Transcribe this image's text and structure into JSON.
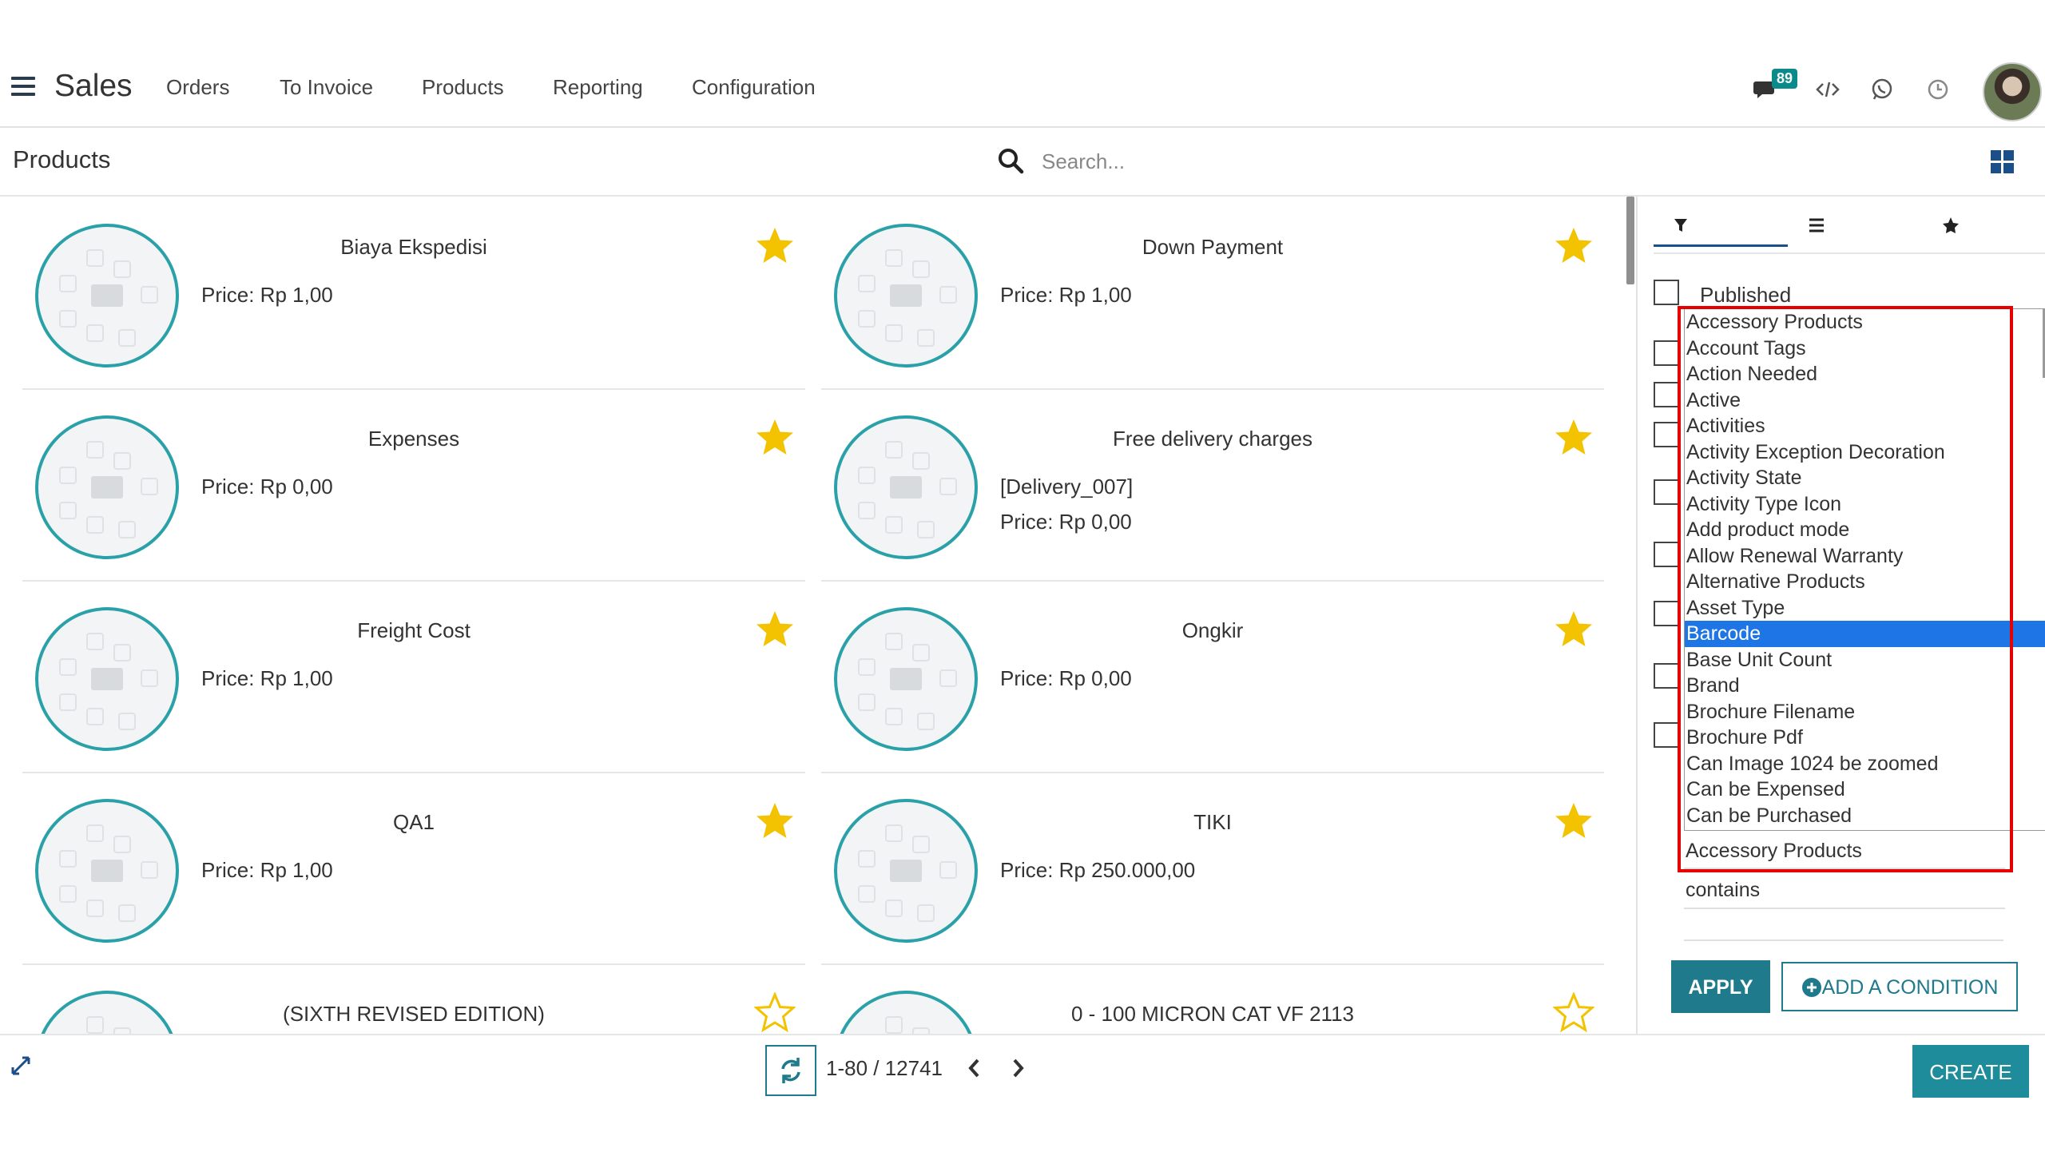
{
  "app": {
    "title": "Sales",
    "notification_count": "89"
  },
  "menu": [
    "Orders",
    "To Invoice",
    "Products",
    "Reporting",
    "Configuration"
  ],
  "breadcrumb": "Products",
  "search": {
    "placeholder": "Search..."
  },
  "products": [
    {
      "name": "Biaya Ekspedisi",
      "line1": "Price: Rp 1,00",
      "line2": "",
      "favorite": true
    },
    {
      "name": "Down Payment",
      "line1": "Price: Rp 1,00",
      "line2": "",
      "favorite": true
    },
    {
      "name": "Expenses",
      "line1": "Price: Rp 0,00",
      "line2": "",
      "favorite": true
    },
    {
      "name": "Free delivery charges",
      "line1": "[Delivery_007]",
      "line2": "Price: Rp 0,00",
      "favorite": true
    },
    {
      "name": "Freight Cost",
      "line1": "Price: Rp 1,00",
      "line2": "",
      "favorite": true
    },
    {
      "name": "Ongkir",
      "line1": "Price: Rp 0,00",
      "line2": "",
      "favorite": true
    },
    {
      "name": "QA1",
      "line1": "Price: Rp 1,00",
      "line2": "",
      "favorite": true
    },
    {
      "name": "TIKI",
      "line1": "Price: Rp 250.000,00",
      "line2": "",
      "favorite": true
    },
    {
      "name": "(SIXTH REVISED EDITION)",
      "line1": "",
      "line2": "",
      "favorite": false
    },
    {
      "name": "0 - 100 MICRON CAT VF 2113",
      "line1": "",
      "line2": "",
      "favorite": false
    }
  ],
  "filter_panel": {
    "published_label": "Published",
    "fields": [
      "Accessory Products",
      "Account Tags",
      "Action Needed",
      "Active",
      "Activities",
      "Activity Exception Decoration",
      "Activity State",
      "Activity Type Icon",
      "Add product mode",
      "Allow Renewal Warranty",
      "Alternative Products",
      "Asset Type",
      "Barcode",
      "Base Unit Count",
      "Brand",
      "Brochure Filename",
      "Brochure Pdf",
      "Can Image 1024 be zoomed",
      "Can be Expensed",
      "Can be Purchased"
    ],
    "selected_field": "Barcode",
    "current_field": "Accessory Products",
    "operator": "contains",
    "apply_label": "APPLY",
    "add_condition_label": "ADD A CONDITION"
  },
  "pager": {
    "text": "1-80 / 12741"
  },
  "create_label": "CREATE",
  "colors": {
    "accent": "#1f7a8c",
    "star": "#f3c200",
    "selection": "#1e75e6",
    "highlight_box": "#e60000"
  }
}
